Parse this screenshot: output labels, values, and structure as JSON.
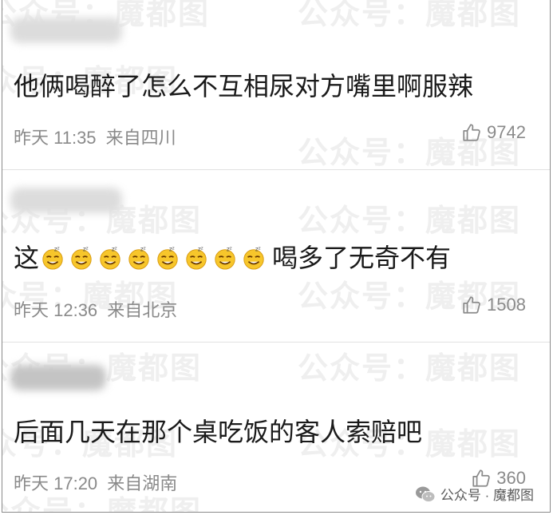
{
  "watermark": {
    "text": "公众号：魔都图"
  },
  "comments": [
    {
      "text": "他俩喝醉了怎么不互相尿对方嘴里啊服辣",
      "time": "昨天 11:35",
      "location": "来自四川",
      "likes": "9742"
    },
    {
      "text_before": "这",
      "emoji": "dizzy-smile-emoji",
      "emoji_count": 8,
      "text_after": "喝多了无奇不有",
      "time": "昨天 12:36",
      "location": "来自北京",
      "likes": "1508"
    },
    {
      "text": "后面几天在那个桌吃饭的客人索赔吧",
      "time": "昨天 17:20",
      "location": "来自湖南",
      "likes": "360"
    }
  ],
  "brand": {
    "label": "公众号 · 魔都图"
  },
  "colors": {
    "text": "#1a1a1a",
    "meta": "#8a8a8a",
    "divider": "#e2e2e2",
    "watermark": "#efefef"
  }
}
